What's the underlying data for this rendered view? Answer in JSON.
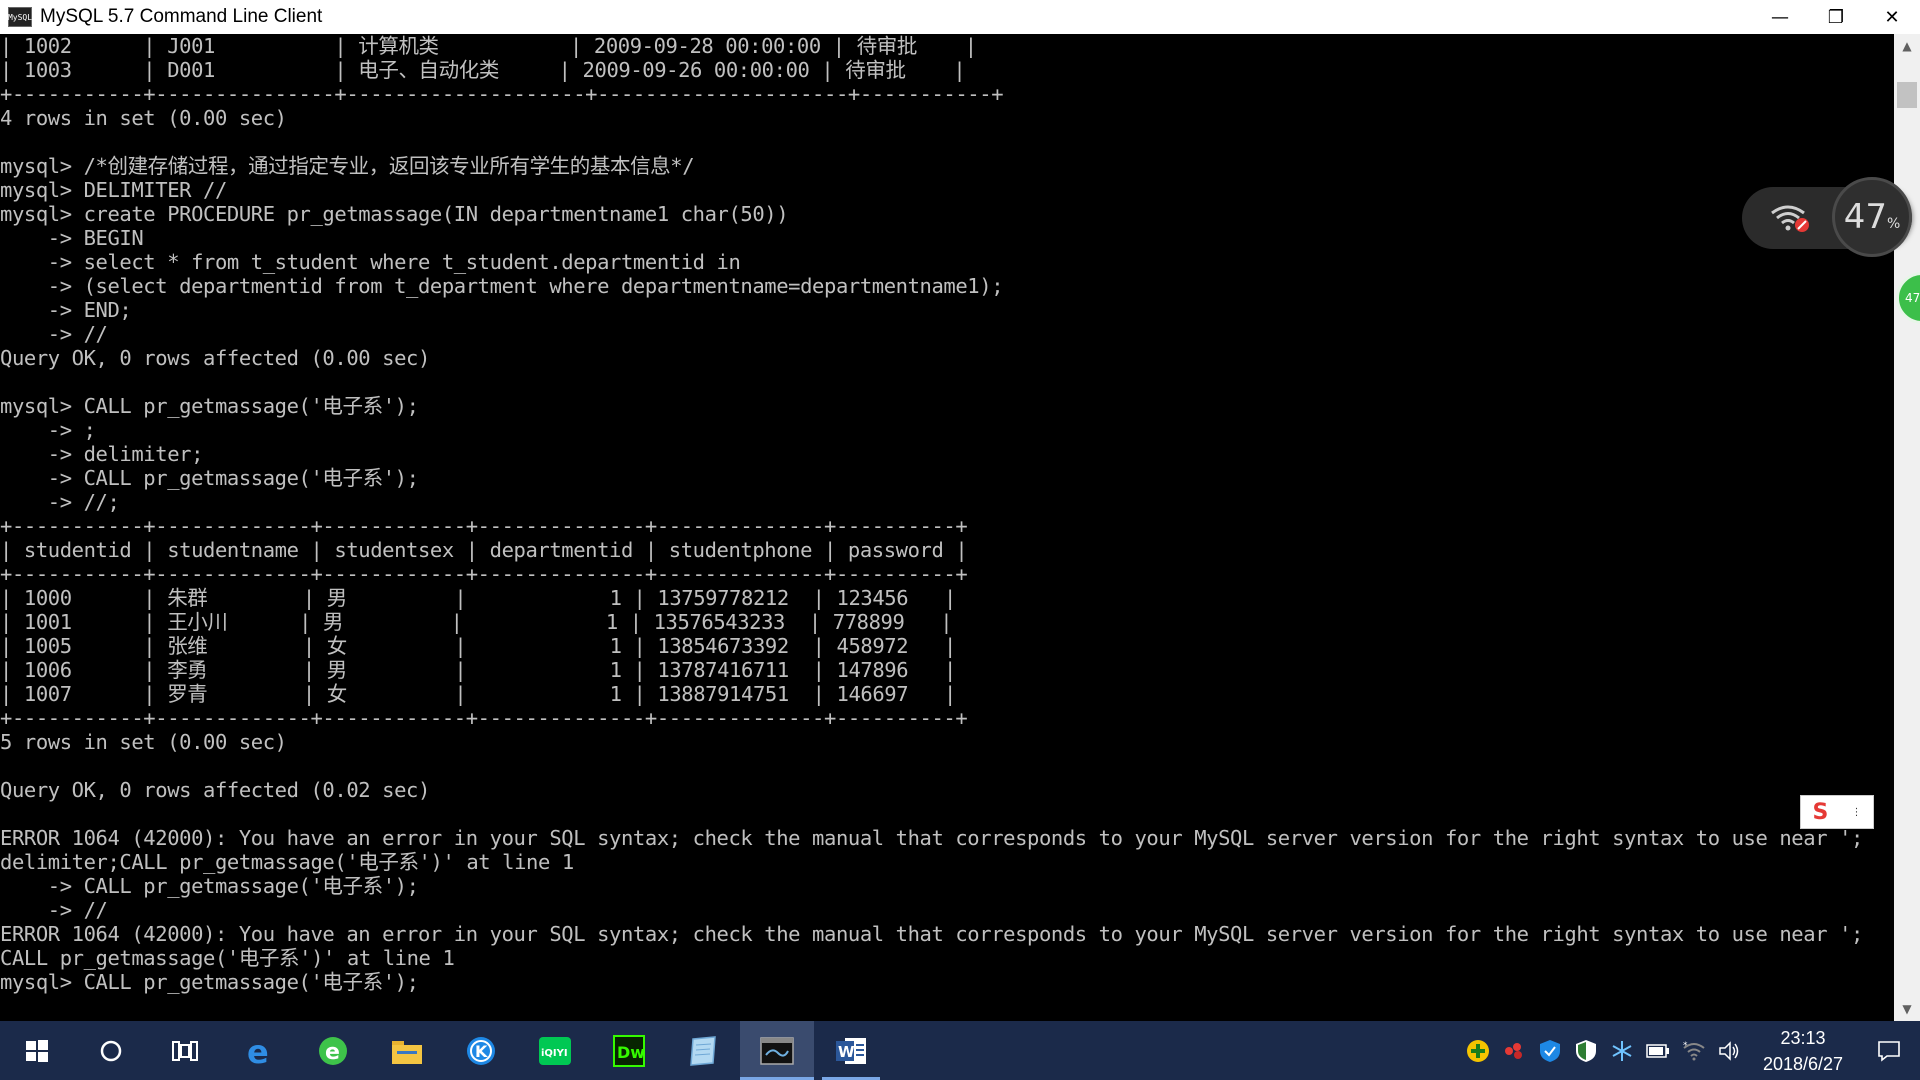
{
  "window": {
    "title": "MySQL 5.7 Command Line Client",
    "app_icon_text": "MySQL",
    "controls": {
      "minimize": "—",
      "maximize": "❐",
      "close": "✕"
    }
  },
  "console": {
    "lines": [
      "| 1002      | J001          | 计算机类           | 2009-09-28 00:00:00 | 待审批    |",
      "| 1003      | D001          | 电子、自动化类     | 2009-09-26 00:00:00 | 待审批    |",
      "+-----------+---------------+--------------------+---------------------+-----------+",
      "4 rows in set (0.00 sec)",
      "",
      "mysql> /*创建存储过程，通过指定专业，返回该专业所有学生的基本信息*/",
      "mysql> DELIMITER //",
      "mysql> create PROCEDURE pr_getmassage(IN departmentname1 char(50))",
      "    -> BEGIN",
      "    -> select * from t_student where t_student.departmentid in",
      "    -> (select departmentid from t_department where departmentname=departmentname1);",
      "    -> END;",
      "    -> //",
      "Query OK, 0 rows affected (0.00 sec)",
      "",
      "mysql> CALL pr_getmassage('电子系');",
      "    -> ;",
      "    -> delimiter;",
      "    -> CALL pr_getmassage('电子系');",
      "    -> //;",
      "+-----------+-------------+------------+--------------+--------------+----------+",
      "| studentid | studentname | studentsex | departmentid | studentphone | password |",
      "+-----------+-------------+------------+--------------+--------------+----------+",
      "| 1000      | 朱群        | 男         |            1 | 13759778212  | 123456   |",
      "| 1001      | 王小川      | 男         |            1 | 13576543233  | 778899   |",
      "| 1005      | 张维        | 女         |            1 | 13854673392  | 458972   |",
      "| 1006      | 李勇        | 男         |            1 | 13787416711  | 147896   |",
      "| 1007      | 罗青        | 女         |            1 | 13887914751  | 146697   |",
      "+-----------+-------------+------------+--------------+--------------+----------+",
      "5 rows in set (0.00 sec)",
      "",
      "Query OK, 0 rows affected (0.02 sec)",
      "",
      "ERROR 1064 (42000): You have an error in your SQL syntax; check the manual that corresponds to your MySQL server version for the right syntax to use near ';",
      "delimiter;CALL pr_getmassage('电子系')' at line 1",
      "    -> CALL pr_getmassage('电子系');",
      "    -> //",
      "ERROR 1064 (42000): You have an error in your SQL syntax; check the manual that corresponds to your MySQL server version for the right syntax to use near ';",
      "CALL pr_getmassage('电子系')' at line 1",
      "mysql> CALL pr_getmassage('电子系');"
    ]
  },
  "scrollbar": {
    "up_arrow": "▲",
    "down_arrow": "▼"
  },
  "net_widget": {
    "percent": "47",
    "percent_sign": "%",
    "badge_text": "47"
  },
  "ime": {
    "logo": "S",
    "menu": "⋮"
  },
  "taskbar": {
    "apps": [
      {
        "name": "start",
        "icon": "windows-logo",
        "active": false,
        "running": false
      },
      {
        "name": "search",
        "icon": "cortana-circle",
        "active": false,
        "running": false
      },
      {
        "name": "task-view",
        "icon": "task-view",
        "active": false,
        "running": false
      },
      {
        "name": "edge",
        "icon": "edge-logo",
        "active": false,
        "running": false
      },
      {
        "name": "browser-360",
        "icon": "browser-360-logo",
        "active": false,
        "running": false
      },
      {
        "name": "file-explorer",
        "icon": "folder",
        "active": false,
        "running": false
      },
      {
        "name": "kugou",
        "icon": "kugou-logo",
        "active": false,
        "running": false
      },
      {
        "name": "iqiyi",
        "icon": "iqiyi-logo",
        "active": false,
        "running": false
      },
      {
        "name": "dreamweaver",
        "icon": "dw-logo",
        "active": false,
        "running": false
      },
      {
        "name": "notepad-app",
        "icon": "notebook",
        "active": false,
        "running": false
      },
      {
        "name": "mysql-client",
        "icon": "mysql-console",
        "active": true,
        "running": true
      },
      {
        "name": "word",
        "icon": "word-logo",
        "active": false,
        "running": true
      }
    ],
    "dw_label": "Dw",
    "iqiyi_label": "iQIYI",
    "kugou_label": "K",
    "word_label": "W",
    "tray": {
      "clock_time": "23:13",
      "clock_date": "2018/6/27"
    }
  },
  "colors": {
    "console_bg": "#000000",
    "console_fg": "#c0c0c0",
    "taskbar_bg": "#1b2a4a",
    "accent": "#7aa7e6"
  }
}
